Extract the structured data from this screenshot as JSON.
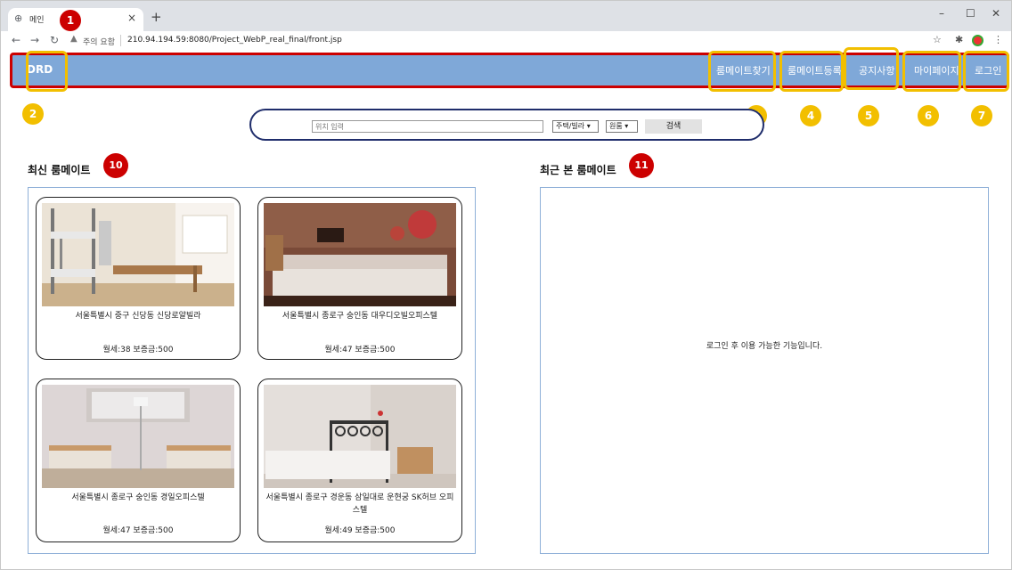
{
  "browser": {
    "tab_title": "메인",
    "tab_close": "×",
    "new_tab": "+",
    "window_controls": [
      "–",
      "☐",
      "✕"
    ],
    "security_warning": "주의 요함",
    "url": "210.94.194.59:8080/Project_WebP_real_final/front.jsp"
  },
  "header": {
    "brand": "DRD",
    "nav": [
      "룸메이트찾기",
      "룸메이트등록",
      "공지사항",
      "마이페이지",
      "로그인"
    ]
  },
  "badges": [
    "1",
    "2",
    "3",
    "4",
    "5",
    "6",
    "7",
    "10",
    "11"
  ],
  "search": {
    "placeholder": "위치 입력",
    "type_select": "주택/빌라",
    "room_select": "원룸",
    "button": "검색"
  },
  "latest": {
    "title": "최신 룸메이트",
    "cards": [
      {
        "address": "서울특별시 중구 신당동 신당로얄빌라",
        "price": "월세:38 보증금:500"
      },
      {
        "address": "서울특별시 종로구 숭인동 대우디오빌오피스텔",
        "price": "월세:47 보증금:500"
      },
      {
        "address": "서울특별시 종로구 숭인동 경일오피스텔",
        "price": "월세:47 보증금:500"
      },
      {
        "address": "서울특별시 종로구 경운동 삼일대로 운현궁 SK허브 오피스텔",
        "price": "월세:49 보증금:500"
      }
    ]
  },
  "recent": {
    "title": "최근 본 룸메이트",
    "message": "로그인 후 이용 가능한 기능입니다."
  },
  "colors": {
    "navbar": "#7fa8d8",
    "navbar_border": "#cc0000",
    "highlight": "#f2bf00",
    "badge_red": "#cc0000",
    "search_border": "#1f2d6b"
  }
}
